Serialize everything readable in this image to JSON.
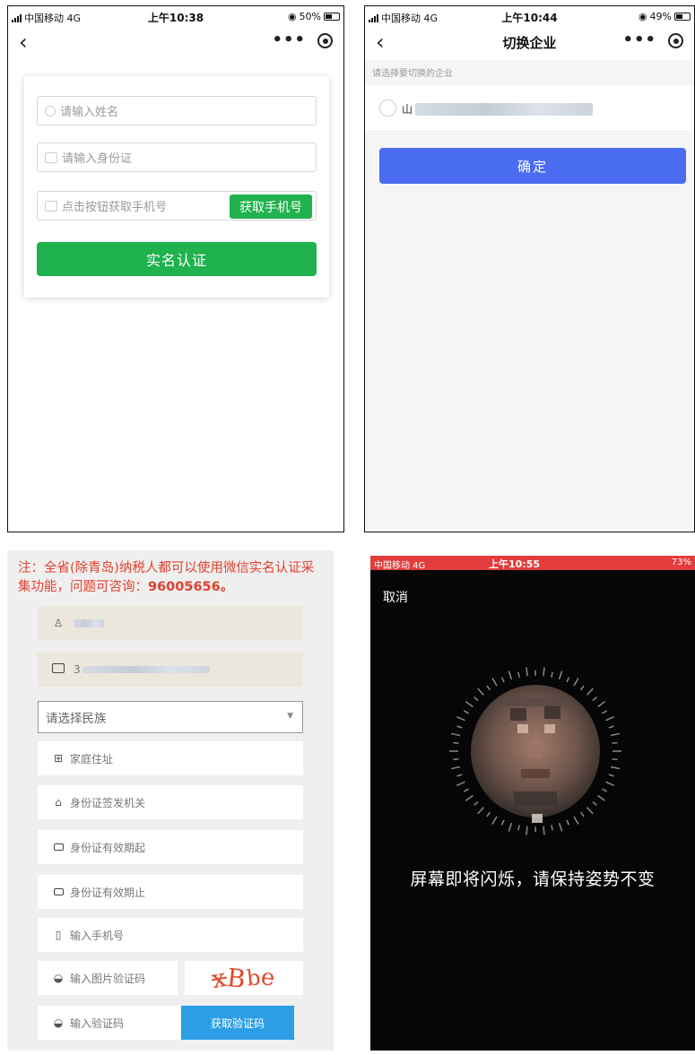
{
  "screen1": {
    "status": {
      "carrier": "中国移动 4G",
      "time": "上午10:38",
      "battery": "50%",
      "battery_level": 0.5
    },
    "name_placeholder": "请输入姓名",
    "id_placeholder": "请输入身份证",
    "phone_placeholder": "点击按钮获取手机号",
    "get_phone_button": "获取手机号",
    "submit_button": "实名认证"
  },
  "screen2": {
    "status": {
      "carrier": "中国移动 4G",
      "time": "上午10:44",
      "battery": "49%",
      "battery_level": 0.49
    },
    "title": "切换企业",
    "hint": "请选择要切换的企业",
    "company_initial": "山",
    "confirm_button": "确定"
  },
  "screen3": {
    "notice_text": "注：全省(除青岛)纳税人都可以使用微信实名认证采集功能，问题可咨询：",
    "notice_phone": "96005656。",
    "id_prefix": "3",
    "ethnicity_placeholder": "请选择民族",
    "address_placeholder": "家庭住址",
    "authority_placeholder": "身份证签发机关",
    "valid_from_placeholder": "身份证有效期起",
    "valid_to_placeholder": "身份证有效期止",
    "phone_placeholder": "输入手机号",
    "image_code_placeholder": "输入图片验证码",
    "captcha_chars": [
      "x",
      "B",
      "b",
      "e"
    ],
    "sms_code_placeholder": "输入验证码",
    "get_code_button": "获取验证码"
  },
  "screen4": {
    "status": {
      "carrier": "中国移动 4G",
      "time": "上午10:55",
      "battery": "73%"
    },
    "cancel": "取消",
    "message": "屏幕即将闪烁，请保持姿势不变"
  },
  "colors": {
    "wechat_green": "#20b24e",
    "blue": "#4a6cf0",
    "notice_red": "#e0412f",
    "link_blue": "#2d9ee6"
  }
}
